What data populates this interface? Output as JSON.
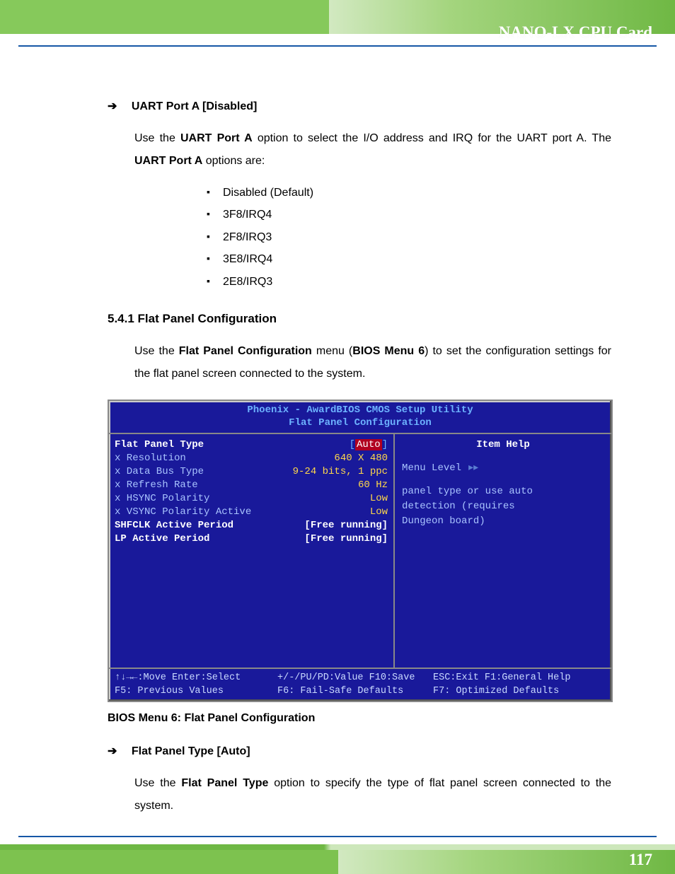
{
  "header": {
    "title": "NANO-LX CPU Card"
  },
  "section_uart": {
    "heading": "UART Port A [Disabled]",
    "para_parts": {
      "p1a": "Use the ",
      "bold1": "UART Port A",
      "p1b": " option to select the I/O address and IRQ for the UART port A. The ",
      "bold2": "UART Port A",
      "p1c": " options are:"
    },
    "options": [
      "Disabled (Default)",
      "3F8/IRQ4",
      "2F8/IRQ3",
      "3E8/IRQ4",
      "2E8/IRQ3"
    ]
  },
  "section_flat": {
    "number_title": "5.4.1 Flat Panel Configuration",
    "para_parts": {
      "a": "Use the ",
      "b": "Flat Panel Configuration",
      "c": " menu (",
      "d": "BIOS Menu 6",
      "e": ") to set the configuration settings for the flat panel screen connected to the system."
    }
  },
  "bios": {
    "title_line1": "Phoenix - AwardBIOS CMOS Setup Utility",
    "title_line2": "Flat Panel Configuration",
    "rows": [
      {
        "label": "Flat Panel Type",
        "label_white": true,
        "value": "Auto",
        "bracket": true,
        "selected": true
      },
      {
        "label": "x Resolution",
        "label_white": false,
        "value": "640 X  480"
      },
      {
        "label": "x Data Bus Type",
        "label_white": false,
        "value": "9-24 bits, 1 ppc"
      },
      {
        "label": "x Refresh Rate",
        "label_white": false,
        "value": "60 Hz"
      },
      {
        "label": "x HSYNC Polarity",
        "label_white": false,
        "value": "Low"
      },
      {
        "label": "x VSYNC Polarity Active",
        "label_white": false,
        "value": "Low"
      },
      {
        "label": "SHFCLK Active Period",
        "label_white": true,
        "value": "Free running",
        "bracket": true,
        "white_val": true
      },
      {
        "label": "LP Active Period",
        "label_white": true,
        "value": "Free running",
        "bracket": true,
        "white_val": true
      }
    ],
    "help": {
      "title": "Item Help",
      "menu_level": "Menu Level",
      "lines": [
        "panel type or use auto",
        "detection (requires",
        "Dungeon board)"
      ]
    },
    "footer": {
      "r1c1": "↑↓→←:Move  Enter:Select",
      "r1c2": "+/-/PU/PD:Value  F10:Save",
      "r1c3": "ESC:Exit  F1:General Help",
      "r2c1": "F5: Previous Values",
      "r2c2": "F6: Fail-Safe Defaults",
      "r2c3": "F7: Optimized Defaults"
    }
  },
  "caption": "BIOS Menu 6: Flat Panel Configuration",
  "section_fpt": {
    "heading": "Flat Panel Type [Auto]",
    "para_parts": {
      "a": "Use the ",
      "b": "Flat Panel Type",
      "c": " option to specify the type of flat panel screen connected to the system."
    }
  },
  "page_number": "117"
}
